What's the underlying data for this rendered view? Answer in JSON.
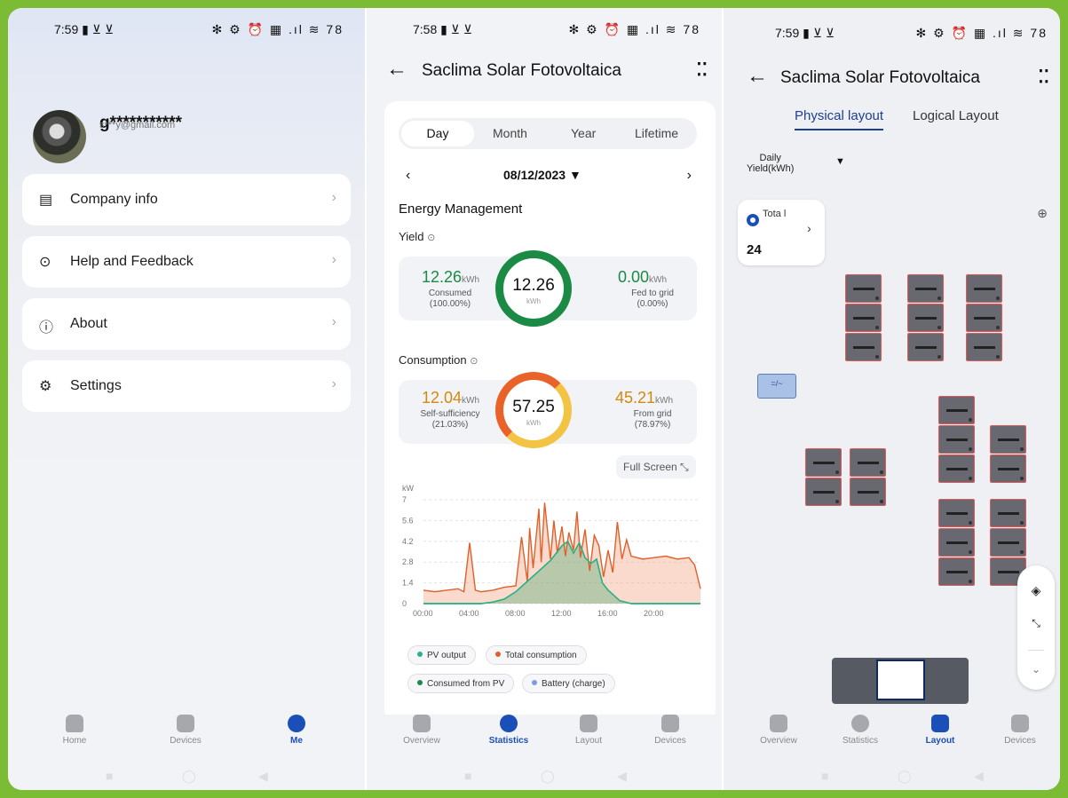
{
  "panel1": {
    "status": {
      "time": "7:59",
      "time_icons": "▮ ⊻ ⊻",
      "right_icons": "✻ ⚙ ⏰ ▦ .ıl ≋ 78"
    },
    "user": {
      "name": "g***********",
      "email": "s***y@gmail.com"
    },
    "menu": [
      {
        "label": "Company info",
        "icon": "company-icon"
      },
      {
        "label": "Help and Feedback",
        "icon": "help-icon"
      },
      {
        "label": "About",
        "icon": "info-icon"
      },
      {
        "label": "Settings",
        "icon": "settings-icon"
      }
    ],
    "nav": {
      "home": "Home",
      "devices": "Devices",
      "me": "Me"
    }
  },
  "panel2": {
    "status": {
      "time": "7:58",
      "time_icons": "▮ ⊻ ⊻",
      "right_icons": "✻ ⚙ ⏰ ▦ .ıl ≋ 78"
    },
    "title": "Saclima Solar Fotovoltaica",
    "tabs": [
      "Day",
      "Month",
      "Year",
      "Lifetime"
    ],
    "date": "08/12/2023",
    "energy_title": "Energy Management",
    "yield": {
      "label": "Yield",
      "center_value": "12.26",
      "center_unit": "kWh",
      "left_value": "12.26",
      "left_unit": "kWh",
      "left_caption": "Consumed",
      "left_pct": "(100.00%)",
      "right_value": "0.00",
      "right_unit": "kWh",
      "right_caption": "Fed to grid",
      "right_pct": "(0.00%)"
    },
    "consumption": {
      "label": "Consumption",
      "center_value": "57.25",
      "center_unit": "kWh",
      "left_value": "12.04",
      "left_unit": "kWh",
      "left_caption": "Self-sufficiency",
      "left_pct": "(21.03%)",
      "right_value": "45.21",
      "right_unit": "kWh",
      "right_caption": "From grid",
      "right_pct": "(78.97%)"
    },
    "full_screen": "Full Screen",
    "legend": [
      "PV output",
      "Total consumption",
      "Consumed from PV",
      "Battery (charge)"
    ],
    "nav": {
      "overview": "Overview",
      "statistics": "Statistics",
      "layout": "Layout",
      "devices": "Devices"
    }
  },
  "chart_data": {
    "type": "line",
    "ylabel": "kW",
    "ylim": [
      0,
      7
    ],
    "yticks": [
      "0",
      "1.4",
      "2.8",
      "4.2",
      "5.6",
      "7"
    ],
    "xticks": [
      "00:00",
      "04:00",
      "08:00",
      "12:00",
      "16:00",
      "20:00"
    ],
    "series": [
      {
        "name": "Total consumption",
        "color": "#e0602a",
        "x": [
          0,
          1,
          2,
          3,
          3.5,
          4,
          4.5,
          5,
          6,
          7,
          8,
          8.5,
          9,
          9.2,
          9.5,
          10,
          10.2,
          10.5,
          11,
          11.3,
          11.6,
          12,
          12.3,
          12.6,
          13,
          13.3,
          13.6,
          14,
          14.4,
          14.8,
          15.2,
          15.6,
          16,
          16.4,
          16.8,
          17.2,
          17.6,
          18,
          19,
          20,
          21,
          22,
          23,
          23.5,
          24
        ],
        "y": [
          0.9,
          0.8,
          0.9,
          1.0,
          0.8,
          4.1,
          0.9,
          0.8,
          0.9,
          1.1,
          1.2,
          4.5,
          1.5,
          5.1,
          2.4,
          6.4,
          2.8,
          6.8,
          3.0,
          5.6,
          3.4,
          5.2,
          3.2,
          4.8,
          3.6,
          6.2,
          3.1,
          5.0,
          2.2,
          4.6,
          3.9,
          1.8,
          3.6,
          2.1,
          5.5,
          3.0,
          4.3,
          3.2,
          3.0,
          3.1,
          3.2,
          3.0,
          3.1,
          2.6,
          1.0
        ]
      },
      {
        "name": "Consumed from PV",
        "color": "#1c8a4a",
        "x": [
          0,
          5,
          6,
          7,
          8,
          9,
          10,
          11,
          11.5,
          12,
          12.5,
          13,
          13.5,
          14,
          14.5,
          15,
          15.5,
          16,
          17,
          18,
          24
        ],
        "y": [
          0,
          0,
          0.1,
          0.3,
          0.8,
          1.5,
          2.2,
          2.9,
          3.4,
          3.9,
          4.2,
          3.4,
          4.1,
          3.1,
          2.7,
          3.0,
          1.4,
          0.9,
          0.2,
          0,
          0
        ]
      },
      {
        "name": "PV output",
        "color": "#27b28a",
        "x": [
          0,
          5,
          6,
          7,
          8,
          9,
          10,
          11,
          11.5,
          12,
          12.5,
          13,
          13.5,
          14,
          14.5,
          15,
          15.5,
          16,
          17,
          18,
          24
        ],
        "y": [
          0,
          0,
          0.1,
          0.3,
          0.8,
          1.5,
          2.2,
          2.9,
          3.4,
          3.9,
          4.2,
          3.4,
          4.1,
          3.1,
          2.7,
          3.0,
          1.4,
          0.9,
          0.2,
          0,
          0
        ]
      }
    ]
  },
  "panel3": {
    "status": {
      "time": "7:59",
      "time_icons": "▮ ⊻ ⊻",
      "right_icons": "✻ ⚙ ⏰ ▦ .ıl ≋ 78"
    },
    "title": "Saclima Solar Fotovoltaica",
    "tabs": {
      "physical": "Physical layout",
      "logical": "Logical Layout"
    },
    "metric": {
      "line1": "Daily",
      "line2": "Yield(kWh)"
    },
    "total": {
      "label": "Tota l",
      "value": "24"
    },
    "inverter_label": "=/~",
    "nav": {
      "overview": "Overview",
      "statistics": "Statistics",
      "layout": "Layout",
      "devices": "Devices"
    }
  }
}
